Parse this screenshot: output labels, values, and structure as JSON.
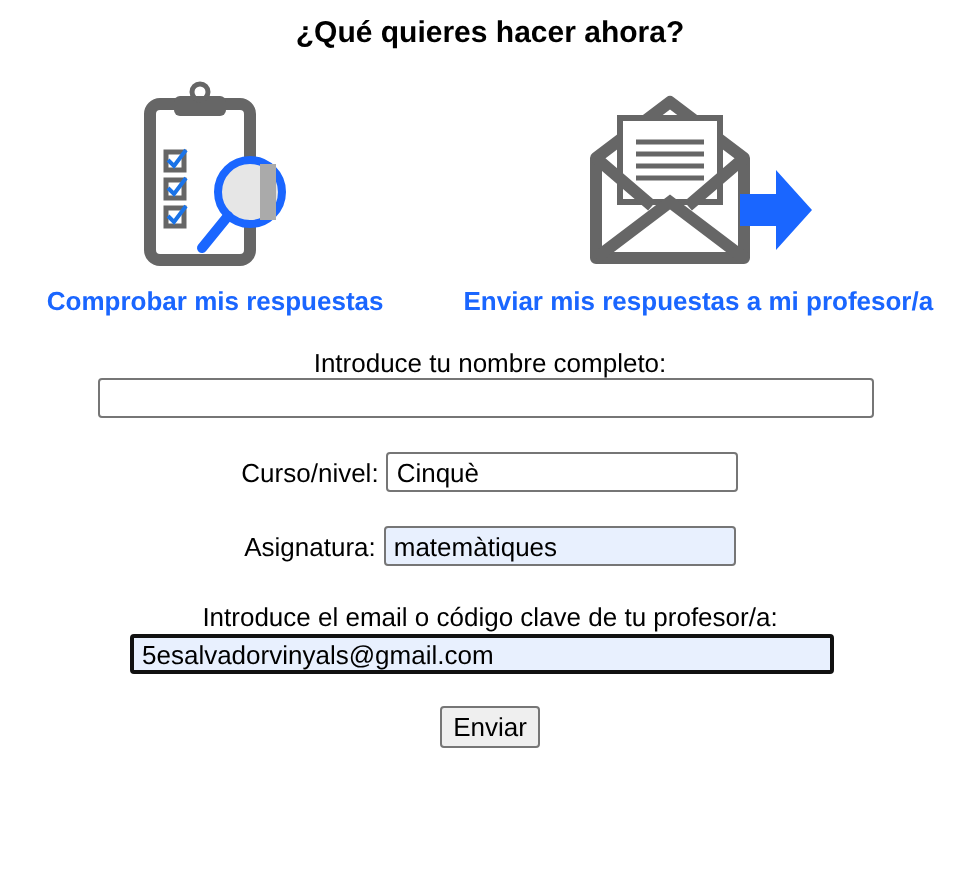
{
  "heading": "¿Qué quieres hacer ahora?",
  "actions": [
    {
      "kind": "check",
      "label": "Comprobar mis respuestas"
    },
    {
      "kind": "send",
      "label": "Enviar mis respuestas a mi profesor/a"
    }
  ],
  "form": {
    "name": {
      "label": "Introduce tu nombre completo:",
      "autofilled": false,
      "focused": false
    },
    "course": {
      "label": "Curso/nivel:",
      "value": "Cinquè",
      "autofilled": false,
      "focused": false
    },
    "subject": {
      "label": "Asignatura:",
      "value": "matemàtiques",
      "autofilled": true,
      "focused": false
    },
    "email": {
      "label": "Introduce el email o código clave de tu profesor/a:",
      "value": "5esalvadorvinyals@gmail.com",
      "autofilled": true,
      "focused": true
    },
    "submit": "Enviar"
  }
}
